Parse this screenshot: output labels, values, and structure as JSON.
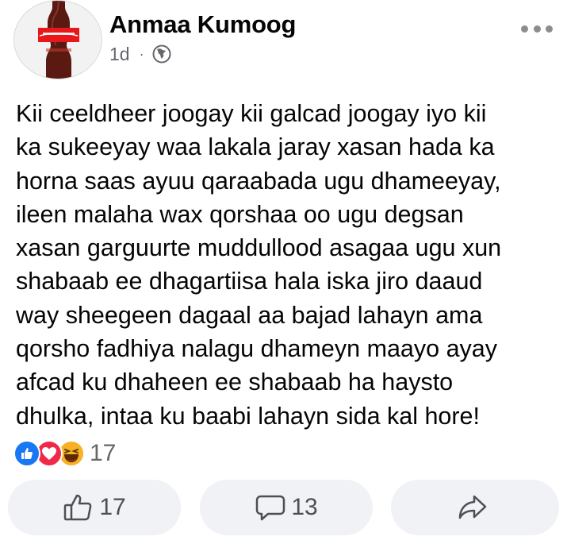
{
  "post": {
    "author": "Anmaa Kumoog",
    "time": "1d",
    "separator": "·",
    "privacy_icon": "globe-icon",
    "menu_icon": "more-dots-icon",
    "text_lines": [
      "Kii ceeldheer joogay kii galcad joogay iyo kii",
      "ka sukeeyay waa lakala jaray xasan hada ka",
      "horna saas ayuu qaraabada ugu dhameeyay,",
      "ileen malaha wax qorshaa oo ugu degsan",
      "xasan garguurte muddullood asagaa ugu xun",
      "shabaab ee dhagartiisa hala iska jiro daaud",
      "way sheegeen dagaal aa bajad lahayn ama",
      "qorsho fadhiya nalagu dhameyn maayo ayay",
      "afcad ku dhaheen ee shabaab ha haysto",
      "dhulka, intaa ku baabi lahayn sida kal hore!"
    ]
  },
  "reactions": {
    "icons": [
      "like-reaction-icon",
      "love-reaction-icon",
      "haha-reaction-icon"
    ],
    "count": "17"
  },
  "actions": {
    "like_count": "17",
    "comment_count": "13"
  },
  "colors": {
    "like_blue": "#1877f2",
    "love_red": "#f0284a",
    "haha_yellow": "#f7b125",
    "button_bg": "#f0f2f5",
    "meta_gray": "#65676b"
  }
}
